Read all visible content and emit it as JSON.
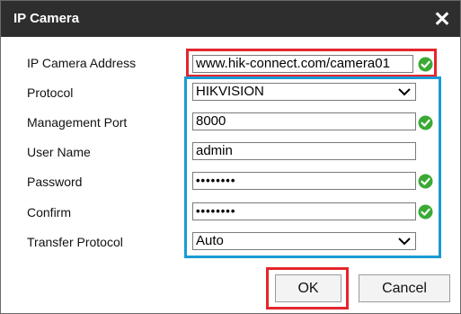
{
  "dialog": {
    "title": "IP Camera",
    "close_icon": "close-icon"
  },
  "form": {
    "address": {
      "label": "IP Camera Address",
      "value": "www.hik-connect.com/camera01"
    },
    "protocol": {
      "label": "Protocol",
      "value": "HIKVISION"
    },
    "port": {
      "label": "Management Port",
      "value": "8000"
    },
    "username": {
      "label": "User Name",
      "value": "admin"
    },
    "password": {
      "label": "Password",
      "value": "••••••••"
    },
    "confirm": {
      "label": "Confirm",
      "value": "••••••••"
    },
    "transfer": {
      "label": "Transfer Protocol",
      "value": "Auto"
    }
  },
  "buttons": {
    "ok": "OK",
    "cancel": "Cancel"
  },
  "colors": {
    "titlebar": "#2e2e2e",
    "valid": "#3aaa35",
    "highlight_red": "#e3262d",
    "highlight_blue": "#1a9ad6"
  }
}
